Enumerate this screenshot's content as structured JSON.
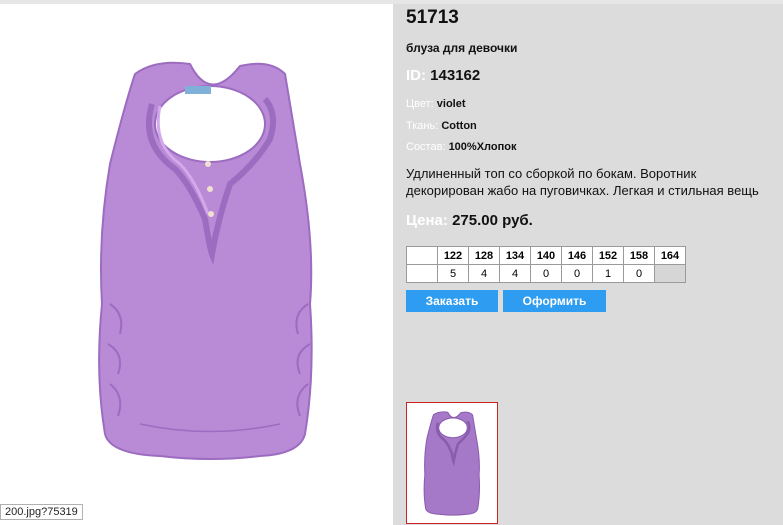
{
  "product": {
    "article": "51713",
    "subtitle": "блуза для девочки",
    "id_label": "ID:",
    "id_value": "143162",
    "color_label": "Цвет:",
    "color_value": "violet",
    "fabric_label": "Ткань:",
    "fabric_value": "Cotton",
    "composition_label": "Состав:",
    "composition_value": "100%Хлопок",
    "description_line1": "Удлиненный топ со сборкой по бокам. Воротник",
    "description_line2": "декорирован жабо на пуговичках. Легкая и стильная вещь",
    "price_label": "Цена:",
    "price_value": "275.00 руб."
  },
  "sizes": {
    "headers": [
      "",
      "122",
      "128",
      "134",
      "140",
      "146",
      "152",
      "158",
      "164"
    ],
    "quantities": [
      "",
      "5",
      "4",
      "4",
      "0",
      "0",
      "1",
      "0",
      ""
    ]
  },
  "buttons": {
    "order_label": "Заказать",
    "checkout_label": "Оформить"
  },
  "image": {
    "tooltip_text": "200.jpg?75319",
    "garment_color": "#b98ad6",
    "garment_shade": "#9c6cc0"
  },
  "colors": {
    "button_blue": "#2e9cf0",
    "thumb_border": "#cc2222",
    "panel_bg": "#dcdcdc"
  }
}
